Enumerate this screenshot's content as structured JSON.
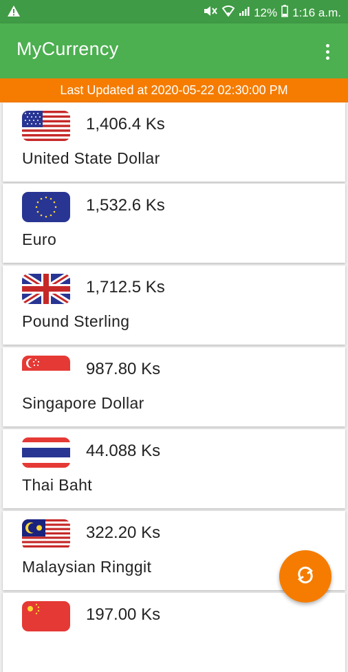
{
  "status_bar": {
    "battery": "12%",
    "time": "1:16 a.m."
  },
  "app_bar": {
    "title": "MyCurrency",
    "menu_icon": "more-vert-icon"
  },
  "banner": {
    "text": "Last Updated at 2020-05-22 02:30:00 PM"
  },
  "currencies": [
    {
      "flag": "us-flag-icon",
      "rate": "1,406.4 Ks",
      "name": "United State Dollar"
    },
    {
      "flag": "eu-flag-icon",
      "rate": "1,532.6 Ks",
      "name": "Euro"
    },
    {
      "flag": "uk-flag-icon",
      "rate": "1,712.5 Ks",
      "name": "Pound Sterling"
    },
    {
      "flag": "sg-flag-icon",
      "rate": "987.80 Ks",
      "name": "Singapore Dollar"
    },
    {
      "flag": "th-flag-icon",
      "rate": "44.088 Ks",
      "name": "Thai Baht"
    },
    {
      "flag": "my-flag-icon",
      "rate": "322.20 Ks",
      "name": "Malaysian Ringgit"
    },
    {
      "flag": "cn-flag-icon",
      "rate": "197.00 Ks",
      "name": ""
    }
  ],
  "fab": {
    "icon": "refresh-sync-icon"
  },
  "colors": {
    "app_bar": "#4caf50",
    "status_bar": "#3f9b45",
    "accent": "#f57c00"
  }
}
